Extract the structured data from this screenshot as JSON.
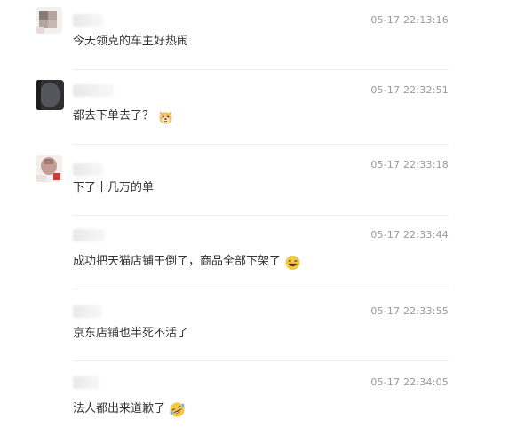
{
  "comments": [
    {
      "time": "05-17 22:13:16",
      "text": "今天领克的车主好热闹",
      "emoji": ""
    },
    {
      "time": "05-17 22:32:51",
      "text": "都去下单去了？",
      "emoji": "doge-emoji"
    },
    {
      "time": "05-17 22:33:18",
      "text": "下了十几万的单",
      "emoji": ""
    },
    {
      "time": "05-17 22:33:44",
      "text": "成功把天猫店铺干倒了，商品全部下架了",
      "emoji": "laugh-sweat-emoji"
    },
    {
      "time": "05-17 22:33:55",
      "text": "京东店铺也半死不活了",
      "emoji": ""
    },
    {
      "time": "05-17 22:34:05",
      "text": "法人都出来道歉了",
      "emoji": "rolling-laugh-emoji"
    }
  ]
}
